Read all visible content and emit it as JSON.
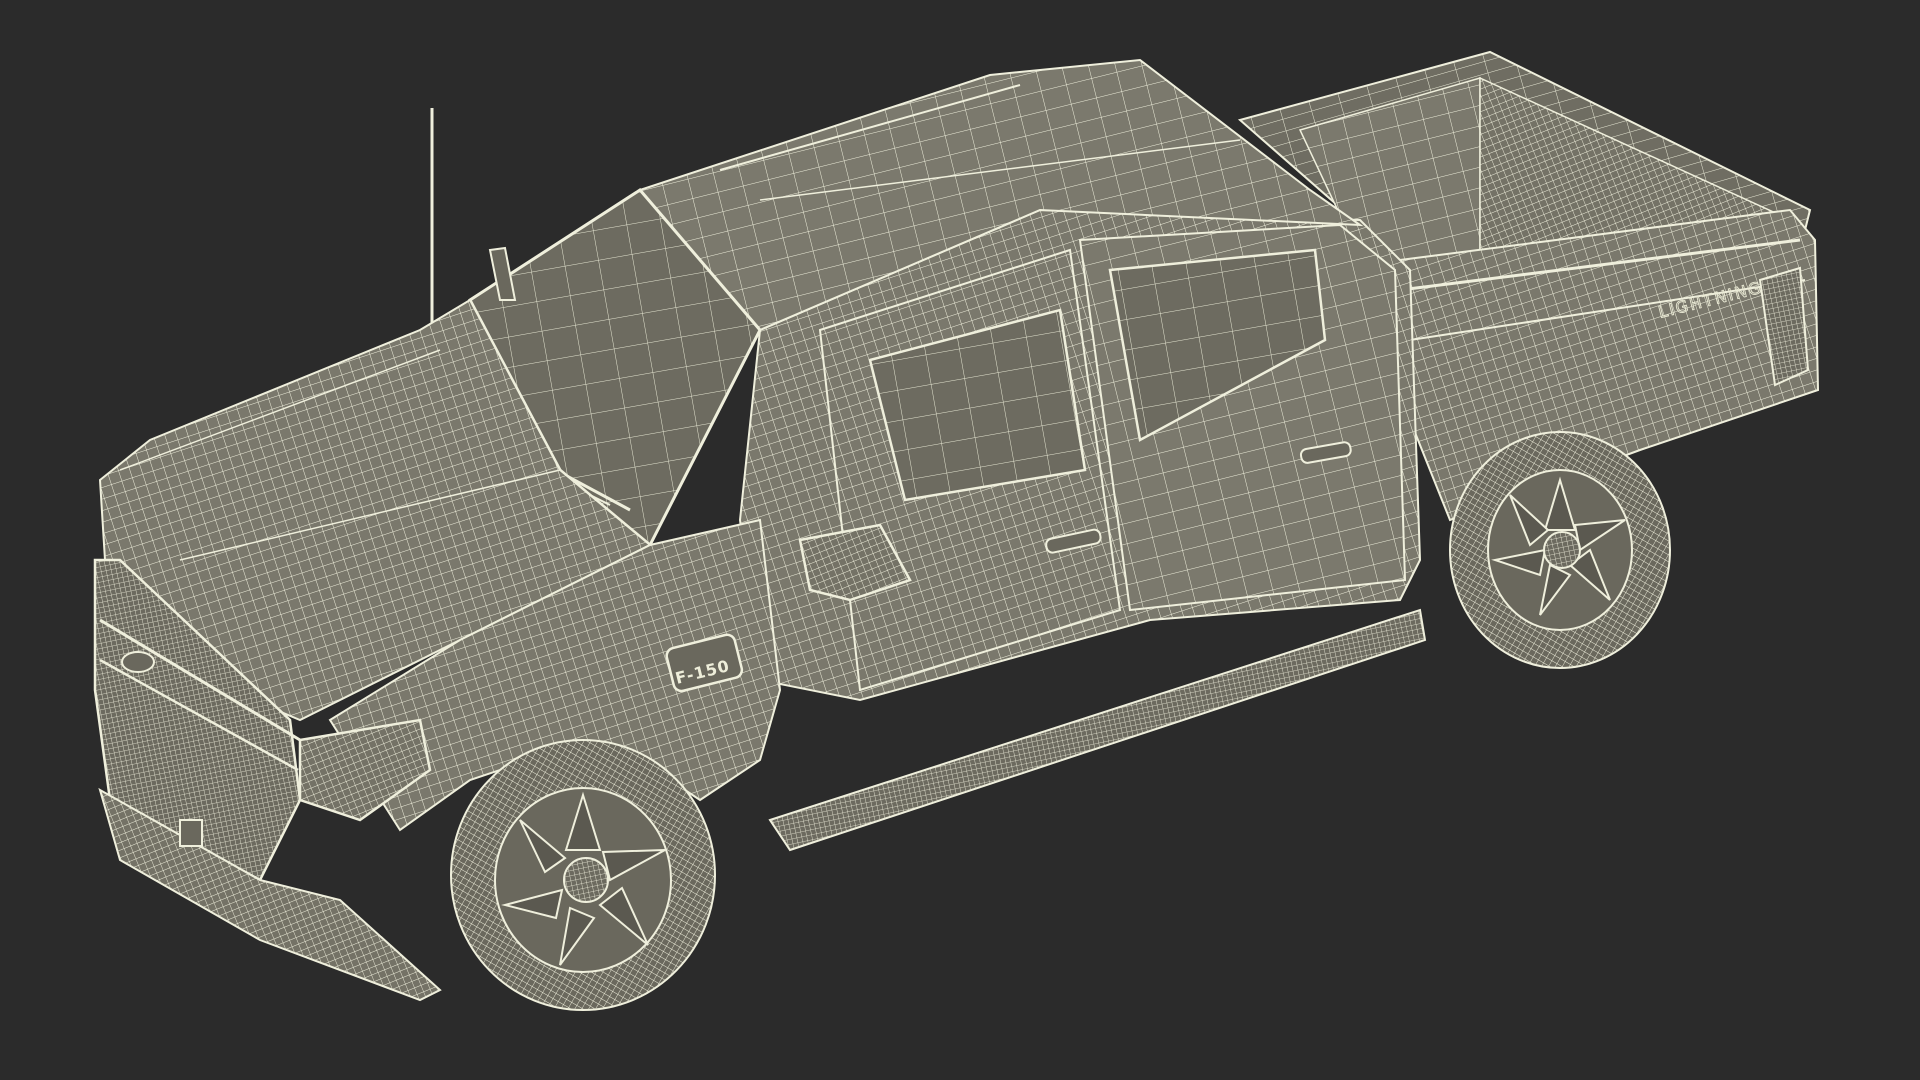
{
  "scene": {
    "background_color": "#2b2b2b",
    "mesh_fill_color": "#7a786c",
    "mesh_dark_fill_color": "#5e5c53",
    "wire_color": "#efefdc",
    "wire_dim_color": "#d9d9c4",
    "render_style": "wireframe-over-shaded"
  },
  "labels": {
    "fender_badge": "F-150",
    "bed_side_script": "LIGHTNING"
  }
}
